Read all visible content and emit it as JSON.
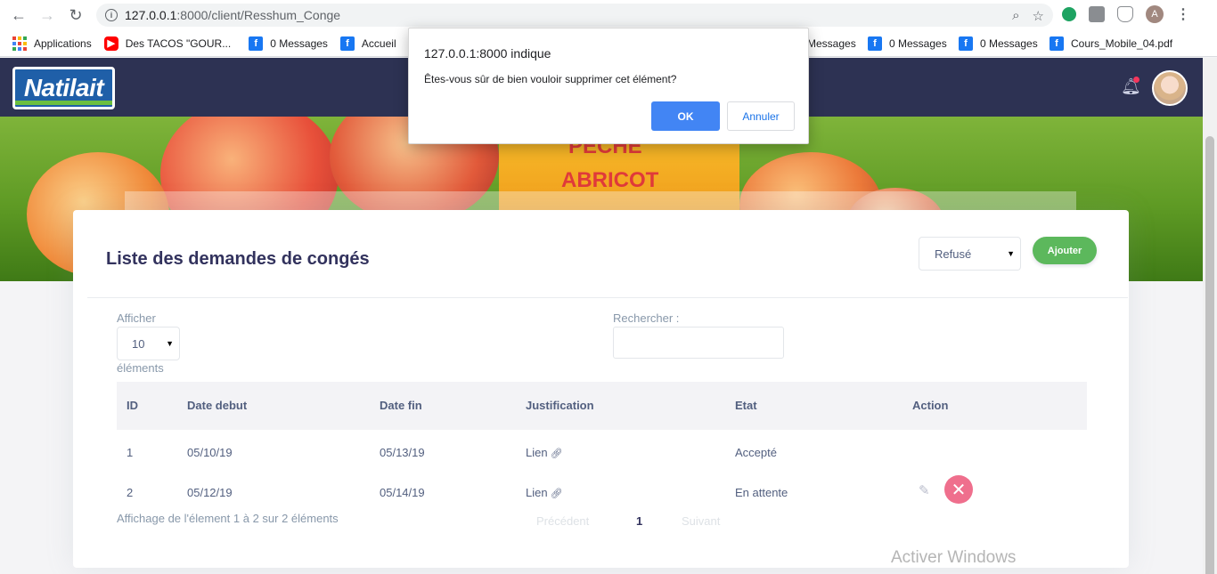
{
  "browser": {
    "url_host": "127.0.0.1",
    "url_rest": ":8000/client/Resshum_Conge",
    "bookmarks": [
      {
        "label": "Applications",
        "icon": "apps-icon"
      },
      {
        "label": "Des TACOS \"GOUR...",
        "icon": "youtube-icon"
      },
      {
        "label": "0 Messages",
        "icon": "facebook-icon"
      },
      {
        "label": "Accueil",
        "icon": "facebook-icon"
      },
      {
        "label": "Messages",
        "icon": "facebook-icon"
      },
      {
        "label": "0 Messages",
        "icon": "facebook-icon"
      },
      {
        "label": "0 Messages",
        "icon": "facebook-icon"
      },
      {
        "label": "Cours_Mobile_04.pdf",
        "icon": "facebook-icon"
      }
    ],
    "profile_initial": "A"
  },
  "header": {
    "logo_text": "Natilait"
  },
  "banner": {
    "carton_line1": "PECHE",
    "carton_line2": "ABRICOT"
  },
  "card": {
    "title": "Liste des demandes de congés",
    "status_filter": "Refusé",
    "add_label": "Ajouter",
    "show_label": "Afficher",
    "page_length": "10",
    "elements_label": "éléments",
    "search_label": "Rechercher :",
    "columns": [
      "ID",
      "Date debut",
      "Date fin",
      "Justification",
      "Etat",
      "Action"
    ],
    "rows": [
      {
        "id": "1",
        "start": "05/10/19",
        "end": "05/13/19",
        "justification": "Lien",
        "state": "Accepté"
      },
      {
        "id": "2",
        "start": "05/12/19",
        "end": "05/14/19",
        "justification": "Lien",
        "state": "En attente"
      }
    ],
    "info": "Affichage de l'élement 1 à 2 sur 2 éléments",
    "prev_label": "Précédent",
    "current_page": "1",
    "next_label": "Suivant"
  },
  "dialog": {
    "title": "127.0.0.1:8000 indique",
    "message": "Êtes-vous sûr de bien vouloir supprimer cet élément?",
    "ok_label": "OK",
    "cancel_label": "Annuler"
  },
  "watermark": "Activer Windows",
  "colors": {
    "header_bg": "#2d3253",
    "accent_blue": "#4285f4",
    "add_green": "#5cb85c",
    "delete_pink": "#ef6f8d"
  }
}
